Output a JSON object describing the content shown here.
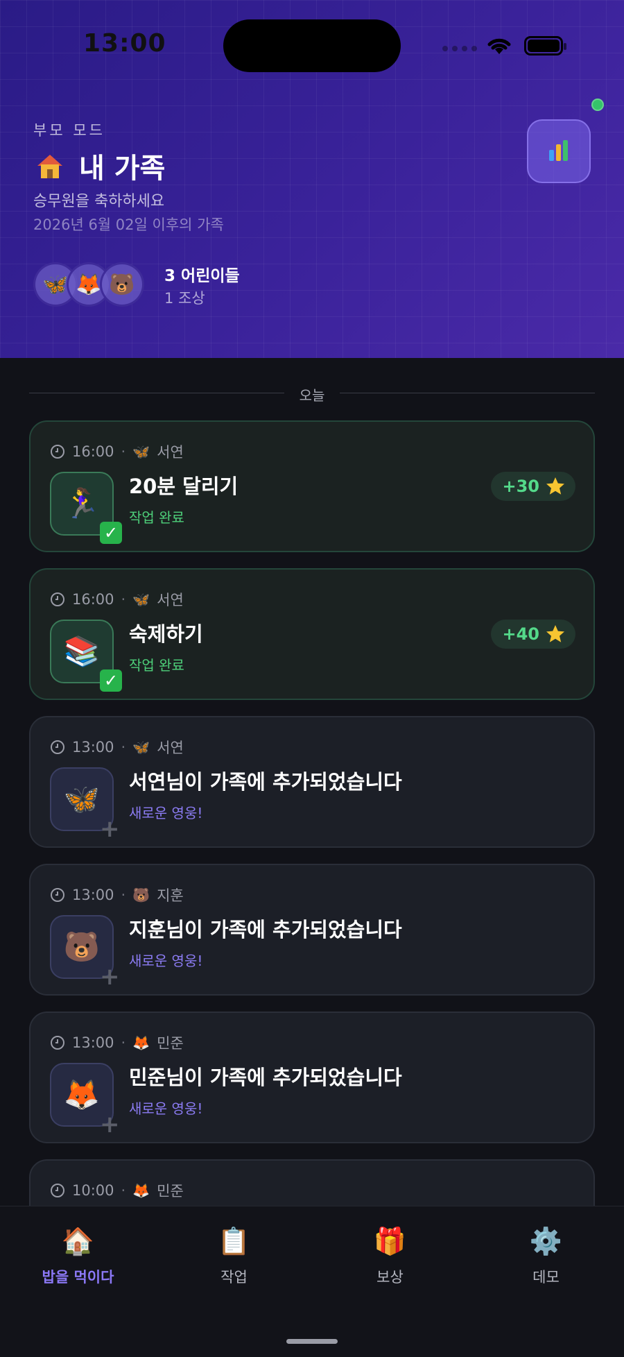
{
  "status_bar": {
    "time": "13:00"
  },
  "header": {
    "mode_label": "부모 모드",
    "title_icon": "house-icon",
    "title": "내 가족",
    "subtitle": "승무원을 축하하세요",
    "since": "2026년 6월 02일 이후의 가족",
    "avatars": [
      {
        "emoji": "🦋",
        "icon": "butterfly-icon"
      },
      {
        "emoji": "🦊",
        "icon": "fox-icon"
      },
      {
        "emoji": "🐻",
        "icon": "bear-icon"
      }
    ],
    "kids_count": "3",
    "kids_label": "어린이들",
    "ancestor_label": "1 조상",
    "stats_icon": "bar-chart-icon",
    "online_color": "#35c46a"
  },
  "feed": {
    "section_label": "오늘",
    "items": [
      {
        "time": "16:00",
        "child_emoji": "🦋",
        "child": "서연",
        "tile_emoji": "🏃‍♀️",
        "title": "20분 달리기",
        "status": "작업 완료",
        "points": "+30",
        "type": "done"
      },
      {
        "time": "16:00",
        "child_emoji": "🦋",
        "child": "서연",
        "tile_emoji": "📚",
        "title": "숙제하기",
        "status": "작업 완료",
        "points": "+40",
        "type": "done"
      },
      {
        "time": "13:00",
        "child_emoji": "🦋",
        "child": "서연",
        "tile_emoji": "🦋",
        "title": "서연님이 가족에 추가되었습니다",
        "status": "새로운 영웅!",
        "type": "added"
      },
      {
        "time": "13:00",
        "child_emoji": "🐻",
        "child": "지훈",
        "tile_emoji": "🐻",
        "title": "지훈님이 가족에 추가되었습니다",
        "status": "새로운 영웅!",
        "type": "added"
      },
      {
        "time": "13:00",
        "child_emoji": "🦊",
        "child": "민준",
        "tile_emoji": "🦊",
        "title": "민준님이 가족에 추가되었습니다",
        "status": "새로운 영웅!",
        "type": "added"
      },
      {
        "time": "10:00",
        "child_emoji": "🦊",
        "child": "민준",
        "type": "partial"
      }
    ]
  },
  "tabs": [
    {
      "label": "밥을 먹이다",
      "emoji": "🏠",
      "icon": "house-icon",
      "active": true
    },
    {
      "label": "작업",
      "emoji": "📋",
      "icon": "clipboard-icon",
      "active": false
    },
    {
      "label": "보상",
      "emoji": "🎁",
      "icon": "gift-icon",
      "active": false
    },
    {
      "label": "데모",
      "emoji": "⚙️",
      "icon": "gear-icon",
      "active": false
    }
  ],
  "colors": {
    "accent": "#8b78f6",
    "success": "#4ed07a",
    "header_start": "#2a1b86",
    "header_end": "#4a2aa8"
  }
}
